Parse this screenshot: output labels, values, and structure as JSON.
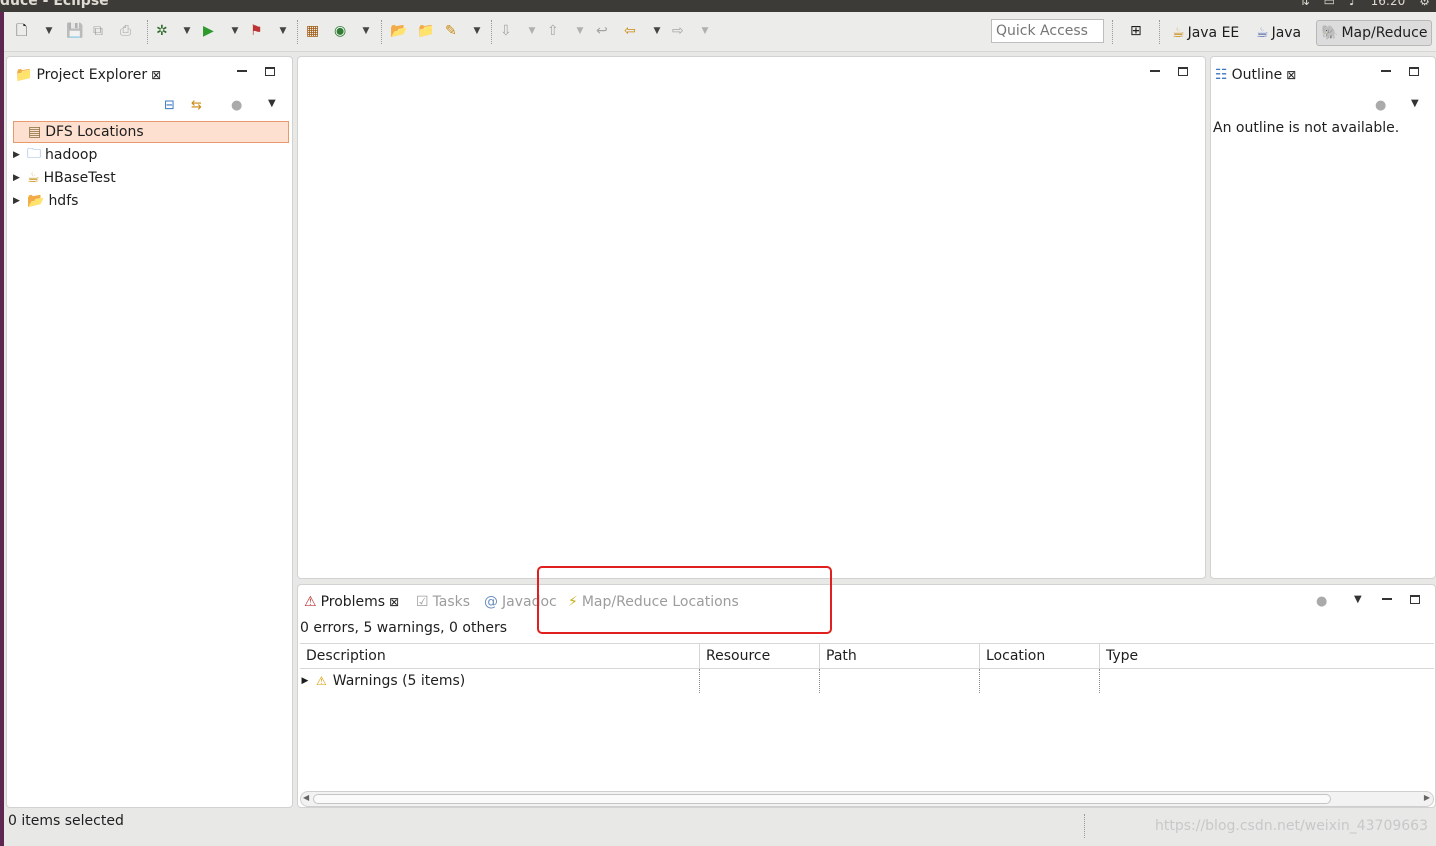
{
  "window": {
    "title": "duce - Eclipse",
    "clock": "16:20"
  },
  "toolbar": {
    "quick_access_placeholder": "Quick Access",
    "perspectives": [
      {
        "label": "Java EE",
        "icon": "java-ee-perspective-icon"
      },
      {
        "label": "Java",
        "icon": "java-perspective-icon"
      },
      {
        "label": "Map/Reduce",
        "icon": "elephant-icon",
        "active": true
      }
    ]
  },
  "project_explorer": {
    "tab_label": "Project Explorer",
    "items": [
      {
        "label": "DFS Locations",
        "icon": "dfs-locations-icon",
        "selected": true,
        "expandable": false
      },
      {
        "label": "hadoop",
        "icon": "folder-icon",
        "expandable": true
      },
      {
        "label": "HBaseTest",
        "icon": "java-project-icon",
        "expandable": true
      },
      {
        "label": "hdfs",
        "icon": "open-folder-icon",
        "expandable": true
      }
    ]
  },
  "outline": {
    "tab_label": "Outline",
    "message": "An outline is not available."
  },
  "bottom_panel": {
    "tabs": [
      {
        "label": "Problems",
        "active": true
      },
      {
        "label": "Tasks",
        "active": false
      },
      {
        "label": "Javadoc",
        "active": false
      },
      {
        "label": "Map/Reduce Locations",
        "active": false
      }
    ],
    "summary": "0 errors, 5 warnings, 0 others",
    "columns": [
      "Description",
      "Resource",
      "Path",
      "Location",
      "Type"
    ],
    "rows": [
      {
        "description": "Warnings (5 items)"
      }
    ]
  },
  "statusbar": {
    "text": "0 items selected",
    "watermark": "https://blog.csdn.net/weixin_43709663"
  }
}
